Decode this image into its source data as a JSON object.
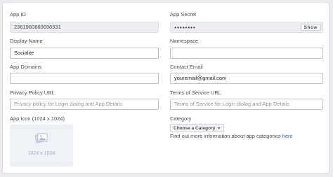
{
  "app_id": {
    "label": "App ID",
    "value": "2361960860696931"
  },
  "app_secret": {
    "label": "App Secret",
    "value": "●●●●●●●●",
    "show_label": "Show"
  },
  "display_name": {
    "label": "Display Name",
    "value": "Socialite"
  },
  "namespace": {
    "label": "Namespace",
    "value": ""
  },
  "app_domains": {
    "label": "App Domains",
    "value": ""
  },
  "contact_email": {
    "label": "Contact Email",
    "value": "youremail@gmail.com"
  },
  "privacy_policy": {
    "label": "Privacy Policy URL",
    "placeholder": "Privacy policy for Login dialog and App Details"
  },
  "terms_of_service": {
    "label": "Terms of Service URL",
    "placeholder": "Terms of Service for Login dialog and App Details"
  },
  "app_icon": {
    "label": "App Icon (1024 x 1024)",
    "dimensions": "1024 x 1024",
    "icon": "image-placeholder-icon"
  },
  "category": {
    "label": "Category",
    "selected": "Choose a Category",
    "help_text": "Find out more information about app categories ",
    "help_link": "here"
  },
  "colors": {
    "background": "#e9ebee",
    "link": "#4267b2",
    "disabled_field": "#ebedf0"
  }
}
